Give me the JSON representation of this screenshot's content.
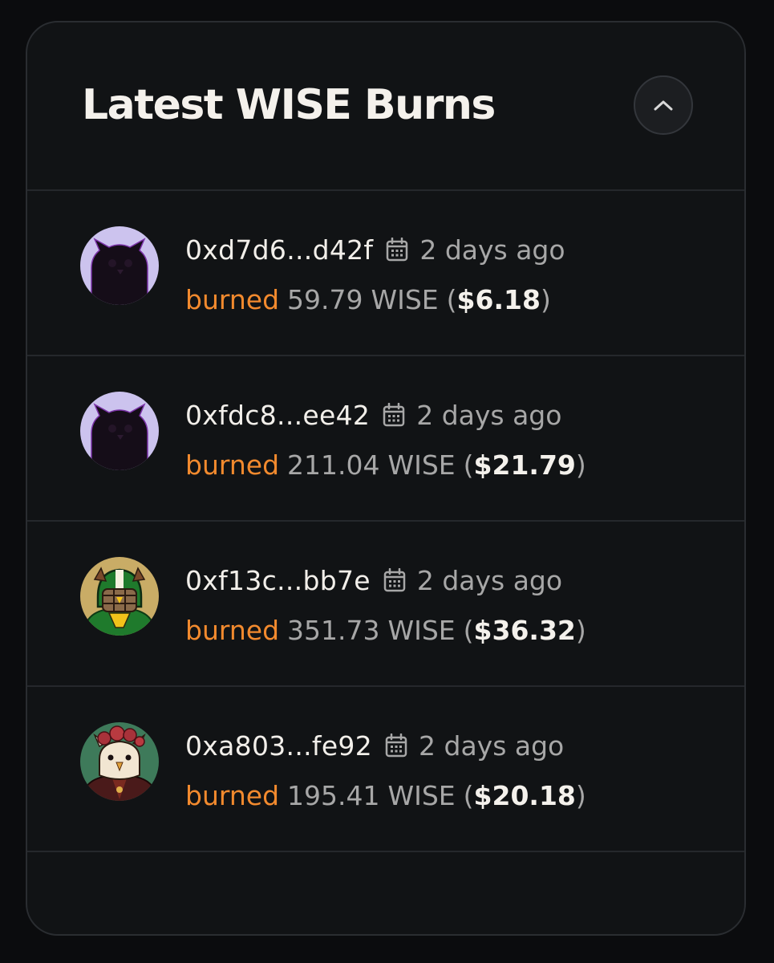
{
  "panel": {
    "title": "Latest WISE Burns",
    "collapse_icon": "chevron-up-icon"
  },
  "burns": [
    {
      "address": "0xd7d6...d42f",
      "time": "2 days ago",
      "action": "burned",
      "amount": "59.79",
      "token": "WISE",
      "usd": "$6.18",
      "avatar": "dark-owl"
    },
    {
      "address": "0xfdc8...ee42",
      "time": "2 days ago",
      "action": "burned",
      "amount": "211.04",
      "token": "WISE",
      "usd": "$21.79",
      "avatar": "dark-owl"
    },
    {
      "address": "0xf13c...bb7e",
      "time": "2 days ago",
      "action": "burned",
      "amount": "351.73",
      "token": "WISE",
      "usd": "$36.32",
      "avatar": "football-owl"
    },
    {
      "address": "0xa803...fe92",
      "time": "2 days ago",
      "action": "burned",
      "amount": "195.41",
      "token": "WISE",
      "usd": "$20.18",
      "avatar": "rose-crown-owl"
    }
  ],
  "colors": {
    "background": "#0b0c0e",
    "card": "#111315",
    "accent": "#f28a2e",
    "text": "#f4f1ec",
    "muted": "#a7a7a7"
  }
}
